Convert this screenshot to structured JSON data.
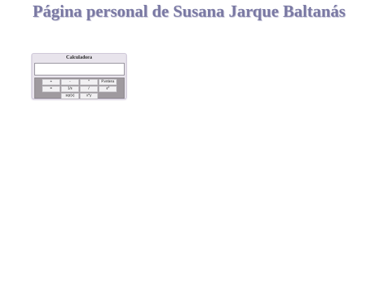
{
  "page": {
    "title": "Página personal de Susana Jarque Baltanás"
  },
  "calculator": {
    "title": "Calculadora",
    "display_value": "",
    "keys": {
      "plus": "+",
      "minus": "-",
      "multiply": "*",
      "integer_part": "P.entera",
      "equals": "=",
      "reciprocal": "1/x",
      "divide": "/",
      "square_base": "x",
      "square_exp": "2",
      "sqrt": "sqr(x)",
      "power_base": "x",
      "power_exp": "^y"
    }
  }
}
